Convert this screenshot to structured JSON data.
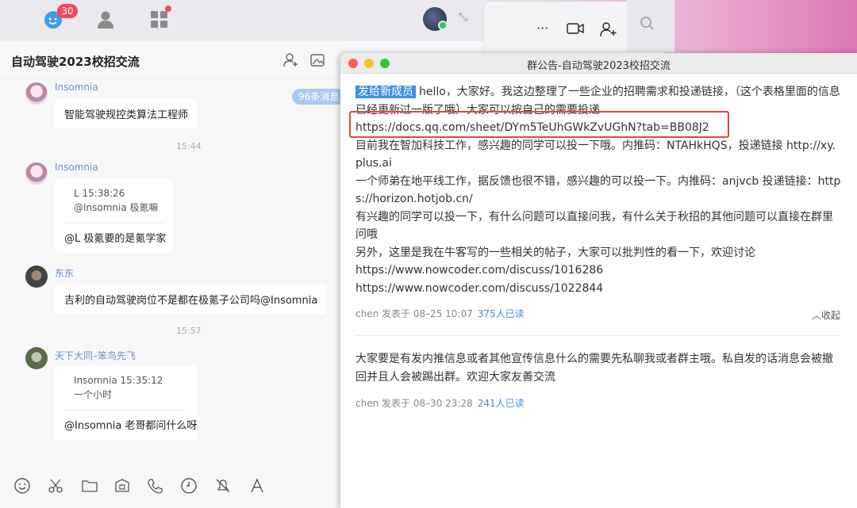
{
  "topbar": {
    "badge_count": "30"
  },
  "chat": {
    "title": "自动驾驶2023校招交流",
    "unread_pill": "96条消息",
    "messages": [
      {
        "sender": "Insomnia",
        "text": "智能驾驶规控类算法工程师"
      },
      {
        "time": "15:44"
      },
      {
        "sender": "Insomnia",
        "quote_head": "L 15:38:26",
        "quote_body": "@Insomnia 极氪嘛",
        "text": "@L 极氪要的是氪学家"
      },
      {
        "sender": "东东",
        "text": "吉利的自动驾驶岗位不是都在极氪子公司吗@Insomnia"
      },
      {
        "time": "15:57"
      },
      {
        "sender": "天下大同–笨鸟先飞",
        "quote_head": "Insomnia 15:35:12",
        "quote_body": "一个小时",
        "text": "@Insomnia 老哥都问什么呀"
      }
    ]
  },
  "announcement": {
    "window_title": "群公告-自动驾驶2023校招交流",
    "tag": "发给新成员",
    "lines": [
      "hello，大家好。我这边整理了一些企业的招聘需求和投递链接，（这个表格里面的信息已经更新过一版了哦）大家可以按自己的需要投递",
      "https://docs.qq.com/sheet/DYm5TeUhGWkZvUGhN?tab=BB08J2",
      "目前我在智加科技工作，感兴趣的同学可以投一下哦。内推码：NTAHkHQS，投递链接 http://xy.plus.ai",
      "一个师弟在地平线工作，据反馈也很不错，感兴趣的可以投一下。内推码：anjvcb 投递链接：https://horizon.hotjob.cn/",
      "有兴趣的同学可以投一下，有什么问题可以直接问我，有什么关于秋招的其他问题可以直接在群里问哦",
      "另外，这里是我在牛客写的一些相关的帖子，大家可以批判性的看一下，欢迎讨论",
      "https://www.nowcoder.com/discuss/1016286",
      "https://www.nowcoder.com/discuss/1022844"
    ],
    "meta1": "chen 发表于 08–25 10:07",
    "read1": "375人已读",
    "collapse": "收起",
    "text2": "大家要是有发内推信息或者其他宣传信息什么的需要先私聊我或者群主哦。私自发的话消息会被撤回并且人会被踢出群。欢迎大家友善交流",
    "meta2": "chen 发表于 08–30 23:28",
    "read2": "241人已读"
  },
  "colors": {
    "accent": "#3e8fe0",
    "badge": "#f2485b",
    "highlight_box": "#e0483c",
    "sender_name": "#6a8fc4"
  }
}
